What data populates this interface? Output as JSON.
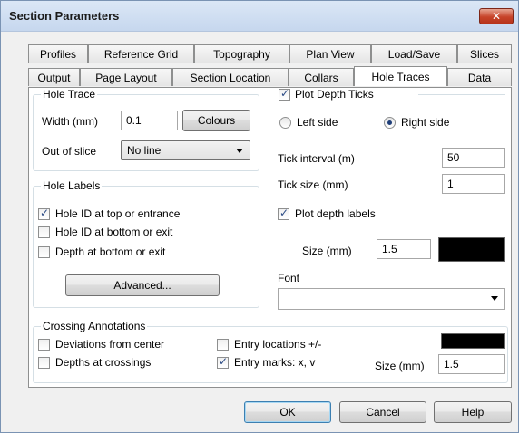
{
  "window": {
    "title": "Section Parameters",
    "close_glyph": "✕"
  },
  "tabs": {
    "row_back": [
      "Profiles",
      "Reference Grid",
      "Topography",
      "Plan View",
      "Load/Save",
      "Slices"
    ],
    "row_front": [
      "Output",
      "Page Layout",
      "Section Location",
      "Collars",
      "Hole Traces",
      "Data"
    ],
    "active": "Hole Traces"
  },
  "hole_trace": {
    "group_label": "Hole Trace",
    "width_label": "Width (mm)",
    "width_value": "0.1",
    "colours_button": "Colours",
    "out_of_slice_label": "Out of slice",
    "out_of_slice_value": "No line"
  },
  "hole_labels": {
    "group_label": "Hole Labels",
    "options": [
      {
        "label": "Hole ID at top or entrance",
        "checked": true
      },
      {
        "label": "Hole ID at bottom or exit",
        "checked": false
      },
      {
        "label": "Depth at bottom or exit",
        "checked": false
      }
    ],
    "advanced_button": "Advanced..."
  },
  "depth_ticks": {
    "plot_label": "Plot Depth Ticks",
    "plot_checked": true,
    "left_side": "Left side",
    "right_side": "Right side",
    "selected_side": "right",
    "tick_interval_label": "Tick interval (m)",
    "tick_interval_value": "50",
    "tick_size_label": "Tick size (mm)",
    "tick_size_value": "1",
    "plot_depth_labels": "Plot depth labels",
    "plot_depth_labels_checked": true,
    "size_label": "Size (mm)",
    "size_value": "1.5",
    "label_color": "#000000",
    "font_label": "Font",
    "font_value": ""
  },
  "crossing": {
    "group_label": "Crossing Annotations",
    "deviations": "Deviations from center",
    "deviations_checked": false,
    "depths": "Depths at crossings",
    "depths_checked": false,
    "entry_locations": "Entry locations +/-",
    "entry_locations_checked": false,
    "entry_marks": "Entry marks: x, v",
    "entry_marks_checked": true,
    "size_label": "Size (mm)",
    "size_value": "1.5",
    "color": "#000000"
  },
  "footer": {
    "ok": "OK",
    "cancel": "Cancel",
    "help": "Help"
  },
  "check_glyph": "✓"
}
